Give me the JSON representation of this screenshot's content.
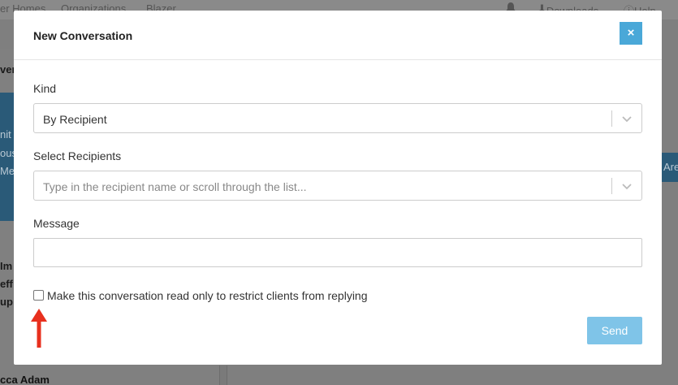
{
  "background": {
    "nav": {
      "partial_1": "er Homes",
      "partial_2": "Organizations",
      "partial_3": "Blazer",
      "downloads": "Downloads",
      "help": "Help"
    },
    "left_fragments": [
      "ver",
      "nit",
      "ous",
      "Me",
      "Im",
      "eff",
      "up"
    ],
    "right_button": "Are",
    "bottom_name": "cca Adam"
  },
  "modal": {
    "title": "New Conversation",
    "close_label": "×",
    "kind": {
      "label": "Kind",
      "value": "By Recipient"
    },
    "recipients": {
      "label": "Select Recipients",
      "placeholder": "Type in the recipient name or scroll through the list..."
    },
    "message": {
      "label": "Message",
      "value": ""
    },
    "read_only_checkbox": {
      "label": "Make this conversation read only to restrict clients from replying",
      "checked": false
    },
    "send_label": "Send"
  },
  "annotation": {
    "arrow_color": "#e8301e"
  }
}
